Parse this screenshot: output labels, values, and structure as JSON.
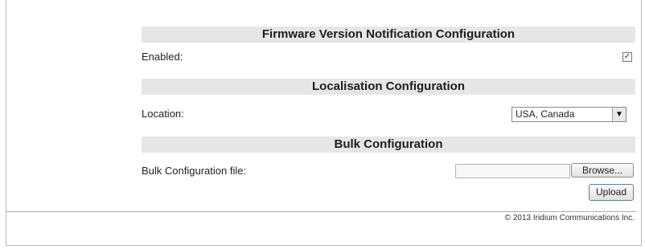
{
  "sections": {
    "firmware": {
      "title": "Firmware Version Notification Configuration",
      "enabled_label": "Enabled:",
      "enabled_checked": true,
      "check_mark": "☑"
    },
    "localisation": {
      "title": "Localisation Configuration",
      "location_label": "Location:",
      "location_value": "USA, Canada",
      "arrow": "▼"
    },
    "bulk": {
      "title": "Bulk Configuration",
      "file_label": "Bulk Configuration file:",
      "file_value": "",
      "browse_label": "Browse...",
      "upload_label": "Upload"
    }
  },
  "footer": {
    "copyright": "© 2013 Iridium Communications Inc."
  },
  "colors": {
    "header_bg": "#e6e6e6",
    "divider": "#e8a14a",
    "border": "#b9b9b9"
  }
}
